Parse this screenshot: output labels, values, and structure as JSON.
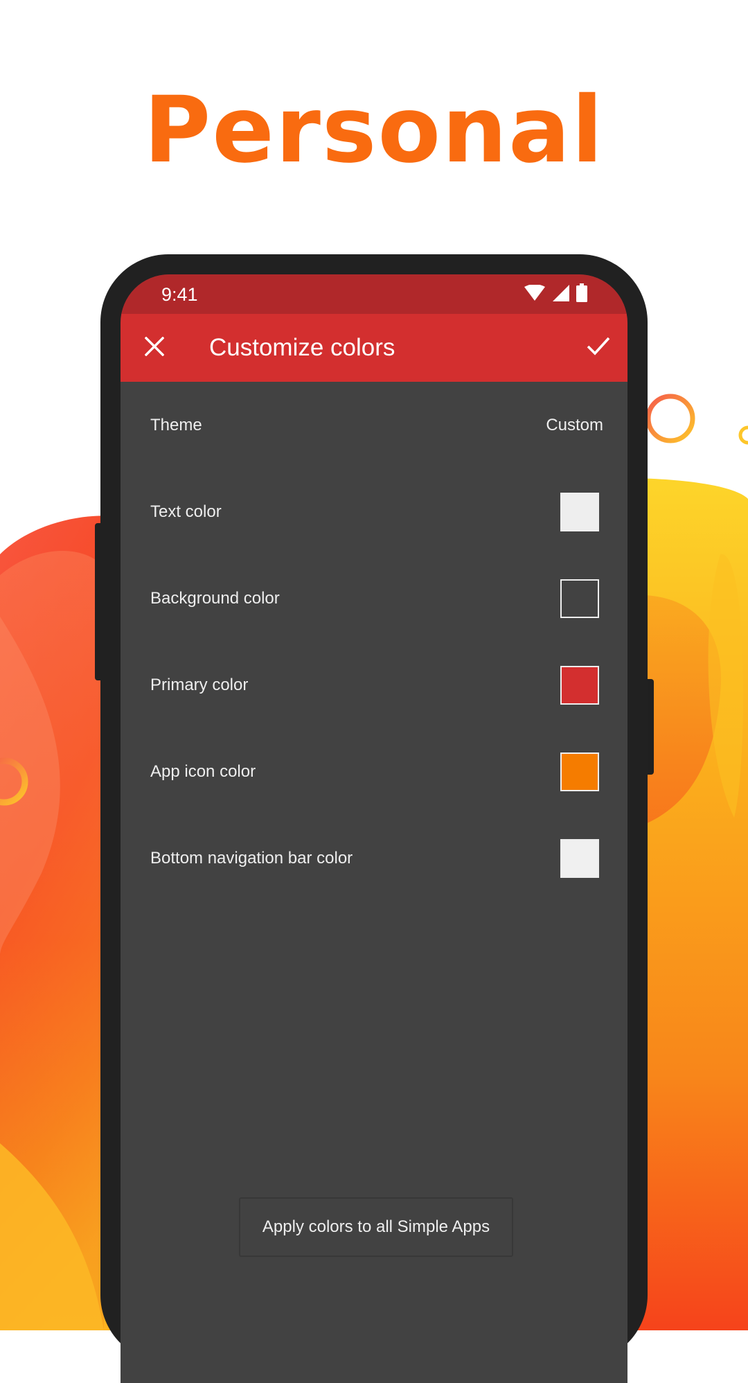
{
  "headline": {
    "text": "Personal",
    "color": "#f96b10"
  },
  "status_bar": {
    "time": "9:41",
    "icons": [
      "wifi-icon",
      "signal-icon",
      "battery-icon"
    ],
    "color": "#b0282a"
  },
  "toolbar": {
    "title": "Customize colors",
    "close_icon": "close-icon",
    "confirm_icon": "check-icon",
    "color": "#d32f2f"
  },
  "settings": {
    "theme": {
      "label": "Theme",
      "value": "Custom"
    },
    "items": [
      {
        "label": "Text color",
        "swatch": "#eeeeee"
      },
      {
        "label": "Background color",
        "swatch": "#424242"
      },
      {
        "label": "Primary color",
        "swatch": "#d32f2f"
      },
      {
        "label": "App icon color",
        "swatch": "#f57c00"
      },
      {
        "label": "Bottom navigation bar color",
        "swatch": "#f0f0f0"
      }
    ]
  },
  "apply_button": {
    "label": "Apply colors to all Simple Apps"
  },
  "colors": {
    "screen_background": "#424242",
    "text": "#eeeeee",
    "phone_frame": "#212121"
  }
}
